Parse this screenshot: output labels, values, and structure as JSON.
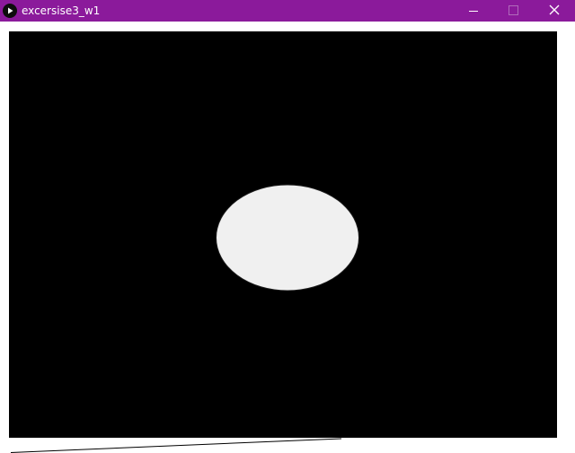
{
  "window": {
    "title": "excersise3_w1",
    "app_icon": "processing-play-icon",
    "controls": [
      "minimize-icon",
      "maximize-icon",
      "close-icon"
    ]
  },
  "colors": {
    "titlebar": "#8b1a9b",
    "sketch_background": "#000000",
    "ellipse_fill": "#f0f0f0",
    "window_background": "#ffffff"
  }
}
